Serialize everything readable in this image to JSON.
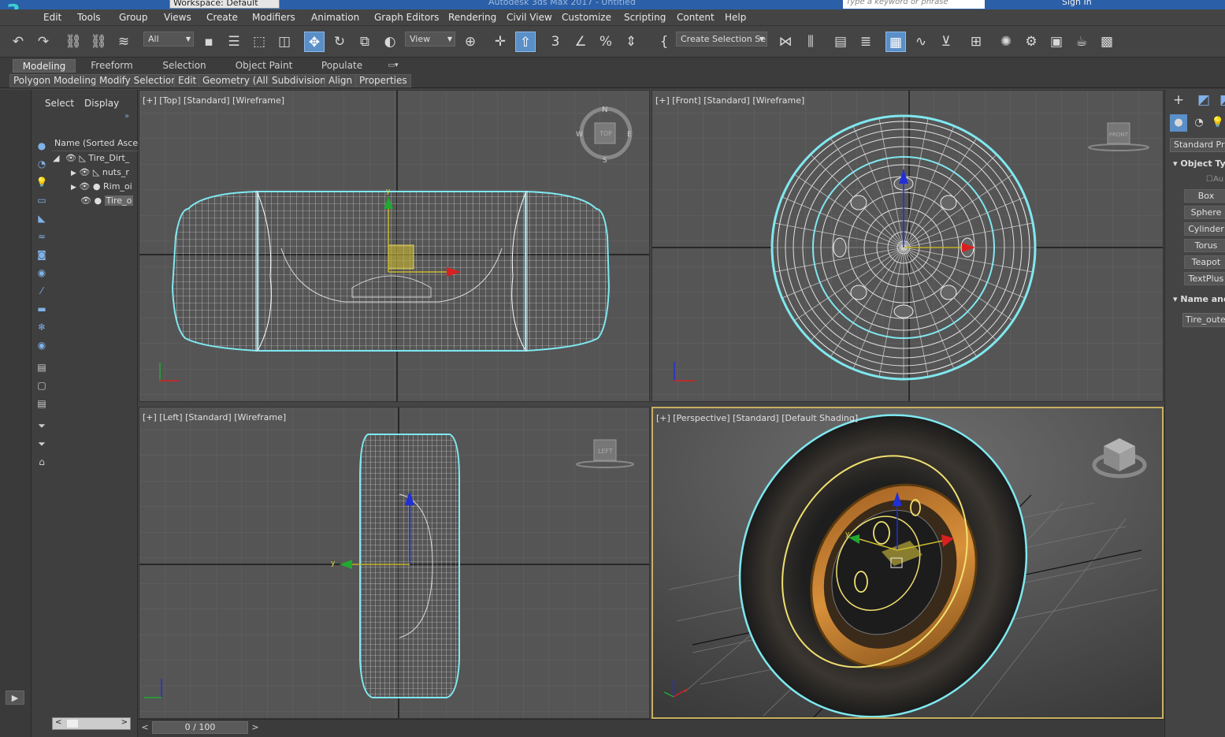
{
  "title_bar": {
    "workspace": "Workspace: Default",
    "app_title": "Autodesk 3ds Max 2017 - Untitled",
    "search_placeholder": "Type a keyword or phrase",
    "sign_in": "Sign In"
  },
  "menu": [
    "Edit",
    "Tools",
    "Group",
    "Views",
    "Create",
    "Modifiers",
    "Animation",
    "Graph Editors",
    "Rendering",
    "Civil View",
    "Customize",
    "Scripting",
    "Content",
    "Help"
  ],
  "toolbar": {
    "selection_filter": "All",
    "reference_coord": "View",
    "selection_set": "Create Selection Se"
  },
  "ribbon_tabs": [
    "Modeling",
    "Freeform",
    "Selection",
    "Object Paint",
    "Populate"
  ],
  "ribbon_panels": [
    "Polygon Modeling",
    "Modify Selection",
    "Edit",
    "Geometry (All)",
    "Subdivision",
    "Align",
    "Properties"
  ],
  "scene_explorer": {
    "tabs": [
      "Select",
      "Display"
    ],
    "column": "Name (Sorted Ascen",
    "items": [
      "Tire_Dirt_",
      "nuts_r",
      "Rim_oi",
      "Tire_o"
    ]
  },
  "viewports": {
    "top": "[+] [Top] [Standard] [Wireframe]",
    "front": "[+] [Front] [Standard] [Wireframe]",
    "left": "[+] [Left] [Standard] [Wireframe]",
    "perspective": "[+] [Perspective] [Standard] [Default Shading]"
  },
  "viewcube": {
    "top": "TOP",
    "front": "FRONT",
    "left": "LEFT",
    "compass_n": "N",
    "compass_s": "S",
    "compass_e": "E",
    "compass_w": "W"
  },
  "command_panel": {
    "dropdown": "Standard Prim",
    "rollout_object_type": "Object Ty",
    "autogrid": "Au",
    "buttons": [
      "Box",
      "Sphere",
      "Cylinder",
      "Torus",
      "Teapot",
      "TextPlus"
    ],
    "rollout_name": "Name and",
    "object_name": "Tire_outer"
  },
  "timeline": {
    "frame": "0 / 100",
    "prev": "<",
    "next": ">"
  },
  "colors": {
    "selection_cyan": "#7fe8f0",
    "selection_yellow": "#f0e070",
    "rim_orange": "#c87a2a",
    "viewport_bg": "#555555",
    "active_border": "#c8b060"
  }
}
